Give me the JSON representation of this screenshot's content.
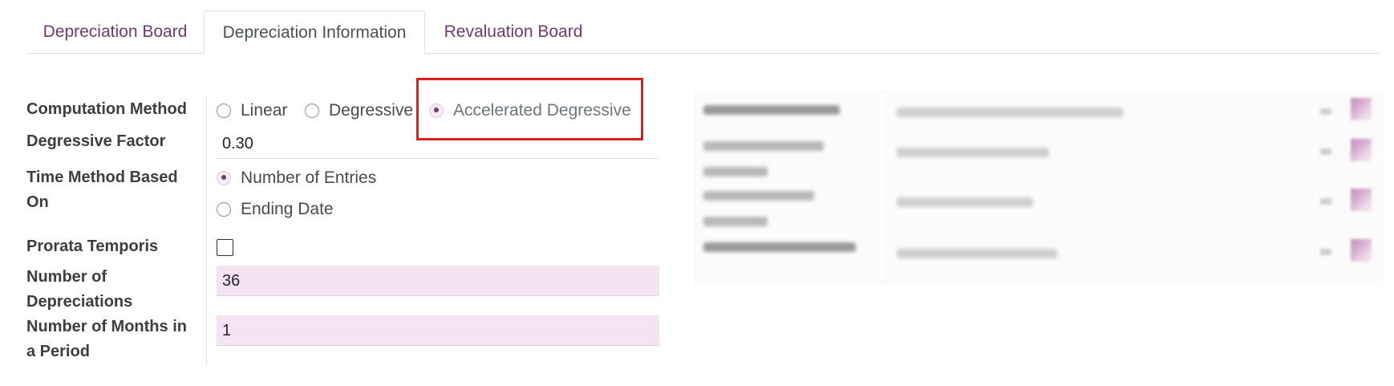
{
  "tabs": [
    {
      "label": "Depreciation Board",
      "active": false
    },
    {
      "label": "Depreciation Information",
      "active": true
    },
    {
      "label": "Revaluation Board",
      "active": false
    }
  ],
  "form": {
    "computation_method": {
      "label": "Computation Method",
      "options": [
        "Linear",
        "Degressive",
        "Accelerated Degressive"
      ],
      "selected": "Accelerated Degressive"
    },
    "degressive_factor": {
      "label": "Degressive Factor",
      "value": "0.30"
    },
    "time_method": {
      "label_line1": "Time Method Based",
      "label_line2": "On",
      "options": [
        "Number of Entries",
        "Ending Date"
      ],
      "selected": "Number of Entries"
    },
    "prorata": {
      "label": "Prorata Temporis",
      "checked": false
    },
    "num_depreciations": {
      "label_line1": "Number of",
      "label_line2": "Depreciations",
      "value": "36"
    },
    "months_period": {
      "label_line1": "Number of Months in",
      "label_line2": "a Period",
      "value": "1"
    }
  },
  "colors": {
    "accent": "#71396c",
    "highlight_border": "#e01b1b",
    "required_field_bg": "#f5e3f3"
  }
}
